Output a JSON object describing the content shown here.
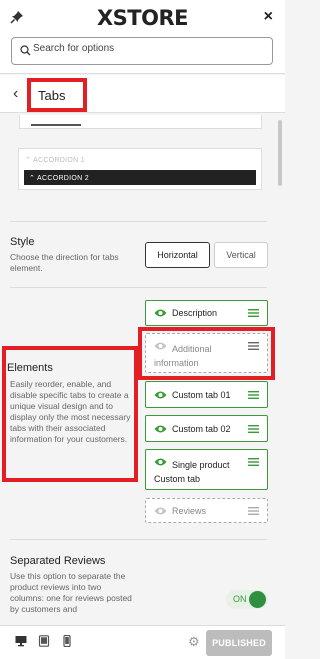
{
  "header": {
    "logo": "XSTORE",
    "close": "×"
  },
  "search": {
    "placeholder": "Search for options",
    "value": ""
  },
  "section": {
    "back": "‹",
    "title": "Tabs"
  },
  "preview": {
    "accordion_1": "⌃ ACCORDION 1",
    "accordion_2": "⌃ ACCORDION 2"
  },
  "style_option": {
    "label": "Style",
    "description": "Choose the direction for tabs element.",
    "options": [
      "Horizontal",
      "Vertical"
    ],
    "selected": "Horizontal"
  },
  "elements": {
    "label": "Elements",
    "description": "Easily reorder, enable, and disable specific tabs to create a unique visual design and to display only the most necessary tabs with their associated information for your customers.",
    "tabs": [
      {
        "label": "Description",
        "enabled": true
      },
      {
        "label": "Additional information",
        "enabled": false
      },
      {
        "label": "Custom tab 01",
        "enabled": true
      },
      {
        "label": "Custom tab 02",
        "enabled": true
      },
      {
        "label": "Single product Custom tab",
        "enabled": true
      },
      {
        "label": "Reviews",
        "enabled": false
      }
    ]
  },
  "separated_reviews": {
    "label": "Separated Reviews",
    "description": "Use this option to separate the product reviews into two columns: one for reviews posted by customers and",
    "toggle_label": "ON",
    "enabled": true
  },
  "footer": {
    "publish_label": "PUBLISHED"
  },
  "colors": {
    "accent_green": "#3a9a3a",
    "highlight_red": "#e31e24",
    "publish_bg": "#bcbcbc"
  }
}
